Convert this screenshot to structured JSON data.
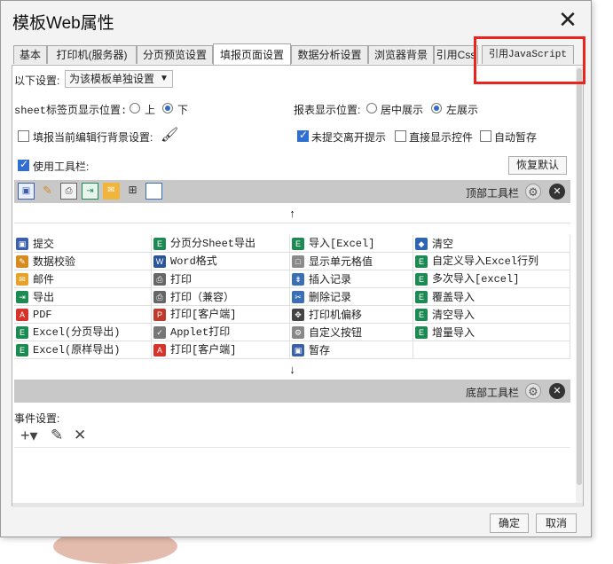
{
  "window": {
    "title": "模板Web属性"
  },
  "tabs": [
    {
      "label": "基本"
    },
    {
      "label": "打印机(服务器)"
    },
    {
      "label": "分页预览设置"
    },
    {
      "label": "填报页面设置"
    },
    {
      "label": "数据分析设置"
    },
    {
      "label": "浏览器背景"
    },
    {
      "label": "引用Css"
    },
    {
      "label": "引用JavaScript"
    }
  ],
  "settings": {
    "scope_label": "以下设置:",
    "scope_value": "为该模板单独设置",
    "sheet_tab_label": "sheet标签页显示位置:",
    "sheet_tab_opt_up": "上",
    "sheet_tab_opt_down": "下",
    "report_pos_label": "报表显示位置:",
    "report_pos_center": "居中展示",
    "report_pos_left": "左展示",
    "fill_bg_label": "填报当前编辑行背景设置:",
    "unsubmitted_label": "未提交离开提示",
    "direct_controls_label": "直接显示控件",
    "autosave_label": "自动暂存",
    "use_toolbar_label": "使用工具栏:",
    "restore_default": "恢复默认"
  },
  "toolbar": {
    "top_label": "顶部工具栏",
    "bottom_label": "底部工具栏",
    "top_icons": [
      "save-icon",
      "pencil-icon",
      "print-icon",
      "export-icon",
      "mail-icon",
      "tree-icon",
      "frame-icon"
    ],
    "up_arrow": "↑",
    "down_arrow": "↓"
  },
  "buttons": [
    [
      {
        "label": "提交",
        "icon": "save-icon",
        "color": "#3b5fa8"
      },
      {
        "label": "分页分Sheet导出",
        "icon": "excel-icon",
        "color": "#1e8a53"
      },
      {
        "label": "导入[Excel]",
        "icon": "excel-icon",
        "color": "#1e8a53"
      },
      {
        "label": "清空",
        "icon": "eraser-icon",
        "color": "#2d65b3"
      }
    ],
    [
      {
        "label": "数据校验",
        "icon": "pencil-icon",
        "color": "#d58b1d"
      },
      {
        "label": "Word格式",
        "icon": "word-icon",
        "color": "#2a5699"
      },
      {
        "label": "显示单元格值",
        "icon": "cell-icon",
        "color": "#8a8a8a"
      },
      {
        "label": "自定义导入Excel行列",
        "icon": "excel-icon",
        "color": "#1e8a53"
      }
    ],
    [
      {
        "label": "邮件",
        "icon": "mail-icon",
        "color": "#e8a128"
      },
      {
        "label": "打印",
        "icon": "print-icon",
        "color": "#666666"
      },
      {
        "label": "插入记录",
        "icon": "insert-row-icon",
        "color": "#3a6fb6"
      },
      {
        "label": "多次导入[excel]",
        "icon": "excel-icon",
        "color": "#1e8a53"
      }
    ],
    [
      {
        "label": "导出",
        "icon": "export-icon",
        "color": "#1e8a53"
      },
      {
        "label": "打印（兼容）",
        "icon": "print-icon",
        "color": "#666666"
      },
      {
        "label": "删除记录",
        "icon": "delete-row-icon",
        "color": "#3a6fb6"
      },
      {
        "label": "覆盖导入",
        "icon": "excel-icon",
        "color": "#1e8a53"
      }
    ],
    [
      {
        "label": "PDF",
        "icon": "pdf-icon",
        "color": "#d6332a"
      },
      {
        "label": "打印[客户端]",
        "icon": "print-client-icon",
        "color": "#c0392b"
      },
      {
        "label": "打印机偏移",
        "icon": "move-icon",
        "color": "#444444"
      },
      {
        "label": "清空导入",
        "icon": "excel-icon",
        "color": "#1e8a53"
      }
    ],
    [
      {
        "label": "Excel(分页导出)",
        "icon": "excel-icon",
        "color": "#1e8a53"
      },
      {
        "label": "Applet打印",
        "icon": "applet-icon",
        "color": "#777777"
      },
      {
        "label": "自定义按钮",
        "icon": "gear-icon",
        "color": "#888888"
      },
      {
        "label": "增量导入",
        "icon": "excel-icon",
        "color": "#1e8a53"
      }
    ],
    [
      {
        "label": "Excel(原样导出)",
        "icon": "excel-icon",
        "color": "#1e8a53"
      },
      {
        "label": "打印[客户端]",
        "icon": "pdf-icon",
        "color": "#d6332a"
      },
      {
        "label": "暂存",
        "icon": "save-icon",
        "color": "#3b5fa8"
      },
      {
        "label": "",
        "icon": "",
        "color": ""
      }
    ]
  ],
  "events": {
    "label": "事件设置:",
    "add": "+▾",
    "edit": "✎",
    "delete": "✕"
  },
  "footer": {
    "ok": "确定",
    "cancel": "取消"
  },
  "colors": {
    "highlight": "#e8251f",
    "accent": "#2f6ed2"
  }
}
